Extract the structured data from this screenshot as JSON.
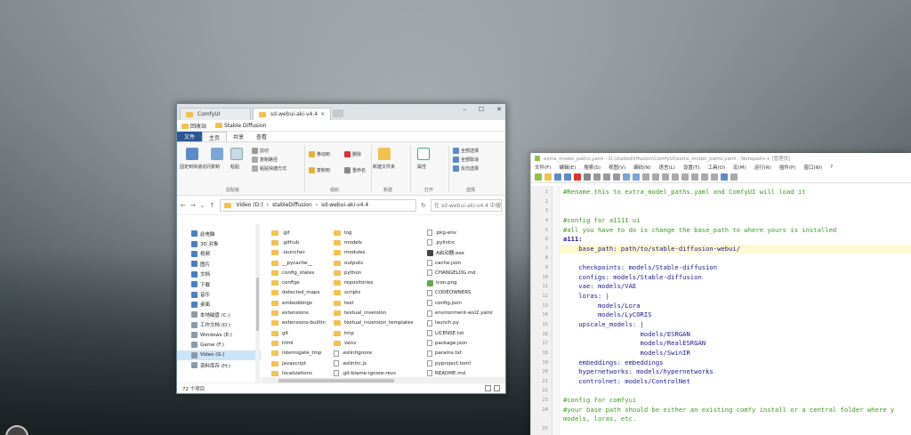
{
  "explorer": {
    "tabs": [
      {
        "label": "ComfyUI"
      },
      {
        "label": "sd-webui-aki-v4.4"
      }
    ],
    "window_controls": [
      "–",
      "☐",
      "✕"
    ],
    "favorites": [
      "回收站",
      "Stable Diffusion"
    ],
    "ribbon_tabs": [
      "文件",
      "主页",
      "共享",
      "查看"
    ],
    "ribbon": {
      "clipboard": {
        "pin": "固定到快速访问",
        "copy": "复制",
        "paste": "粘贴",
        "cut": "剪切",
        "copy_path": "复制路径",
        "paste_shortcut": "粘贴快捷方式",
        "group": "剪贴板"
      },
      "organize": {
        "move_to": "移动到",
        "delete": "删除",
        "copy_to": "复制到",
        "rename": "重命名",
        "group": "组织"
      },
      "new": {
        "new_folder": "新建文件夹",
        "group": "新建"
      },
      "open": {
        "properties": "属性",
        "group": "打开"
      },
      "select": {
        "select_all": "全部选择",
        "select_none": "全部取消",
        "invert": "反向选择",
        "group": "选择"
      }
    },
    "address": {
      "path": [
        "Video (D:)",
        "stableDiffusion",
        "sd-webui-aki-v4.4"
      ],
      "search_placeholder": "在 sd-webui-aki-v4.4 中搜索"
    },
    "nav_items": [
      {
        "label": "此电脑",
        "icon": "computer-icon"
      },
      {
        "label": "3D 对象",
        "icon": "cube-icon"
      },
      {
        "label": "视频",
        "icon": "video-icon"
      },
      {
        "label": "图片",
        "icon": "picture-icon"
      },
      {
        "label": "文档",
        "icon": "document-icon"
      },
      {
        "label": "下载",
        "icon": "download-icon"
      },
      {
        "label": "音乐",
        "icon": "music-icon"
      },
      {
        "label": "桌面",
        "icon": "desktop-icon"
      },
      {
        "label": "本地磁盘 (C:)",
        "icon": "drive-icon"
      },
      {
        "label": "工作文档 (D:)",
        "icon": "drive-icon"
      },
      {
        "label": "Windows (E:)",
        "icon": "drive-icon"
      },
      {
        "label": "Game (F:)",
        "icon": "drive-icon"
      },
      {
        "label": "Video (G:)",
        "icon": "drive-icon",
        "selected": true
      },
      {
        "label": "资料库存 (H:)",
        "icon": "drive-icon"
      }
    ],
    "files": {
      "col1": [
        ".git",
        ".github",
        ".launcher",
        "__pycache__",
        "config_states",
        "configs",
        "detected_maps",
        "embeddings",
        "extensions",
        "extensions-builtin",
        "git",
        "html",
        "interrogate_tmp",
        "javascript",
        "localizations"
      ],
      "col2": [
        "log",
        "models",
        "modules",
        "outputs",
        "python",
        "repositories",
        "scripts",
        "test",
        "textual_inversion",
        "textual_inversion_templates",
        "tmp",
        "venv",
        ".eslintignore",
        ".eslintrc.js",
        ".git-blame-ignore-revs"
      ],
      "col3": [
        ".pkg-env",
        ".pylintrc",
        "A启动器.exe",
        "cache.json",
        "CHANGELOG.md",
        "icon.png",
        "CODEOWNERS",
        "config.json",
        "environment-wsl2.yaml",
        "launch.py",
        "LICENSE.txt",
        "package.json",
        "params.txt",
        "pyproject.toml",
        "README.md"
      ]
    },
    "file_icons": {
      "col3": [
        "file",
        "file",
        "exe",
        "file",
        "file",
        "image",
        "file",
        "file",
        "file",
        "file",
        "file",
        "file",
        "file",
        "file",
        "file"
      ]
    },
    "status": "72 个项目"
  },
  "notepad": {
    "title": "extra_model_paths.yaml - D:\\stableDiffusion\\ComfyUI\\extra_model_paths.yaml - Notepad++ [管理员]",
    "menu": [
      "文件(F)",
      "编辑(E)",
      "搜索(S)",
      "视图(V)",
      "编码(N)",
      "语言(L)",
      "设置(T)",
      "工具(O)",
      "宏(M)",
      "运行(R)",
      "插件(P)",
      "窗口(W)",
      "?"
    ],
    "lines": [
      {
        "n": "1",
        "t": "#Rename this to extra_model_paths.yaml and ComfyUI will load it",
        "c": "cmt"
      },
      {
        "n": "2",
        "t": "",
        "c": ""
      },
      {
        "n": "3",
        "t": "",
        "c": ""
      },
      {
        "n": "4",
        "t": "#config for a1111 ui",
        "c": "cmt"
      },
      {
        "n": "5",
        "t": "#all you have to do is change the base_path to where yours is installed",
        "c": "cmt"
      },
      {
        "n": "6",
        "t": "a111:",
        "c": "key"
      },
      {
        "n": "7",
        "t": "    base_path: path/to/stable-diffusion-webui/",
        "c": "val",
        "hl": true
      },
      {
        "n": "8",
        "t": "",
        "c": ""
      },
      {
        "n": "9",
        "t": "    checkpoints: models/Stable-diffusion",
        "c": "val"
      },
      {
        "n": "10",
        "t": "    configs: models/Stable-diffusion",
        "c": "val"
      },
      {
        "n": "11",
        "t": "    vae: models/VAE",
        "c": "val"
      },
      {
        "n": "12",
        "t": "    loras: |",
        "c": "val"
      },
      {
        "n": "13",
        "t": "         models/Lora",
        "c": "val"
      },
      {
        "n": "14",
        "t": "         models/LyCORIS",
        "c": "val"
      },
      {
        "n": "15",
        "t": "    upscale_models: |",
        "c": "val"
      },
      {
        "n": "16",
        "t": "                    models/ESRGAN",
        "c": "val"
      },
      {
        "n": "17",
        "t": "                    models/RealESRGAN",
        "c": "val"
      },
      {
        "n": "18",
        "t": "                    models/SwinIR",
        "c": "val"
      },
      {
        "n": "19",
        "t": "    embeddings: embeddings",
        "c": "val"
      },
      {
        "n": "20",
        "t": "    hypernetworks: models/hypernetworks",
        "c": "val"
      },
      {
        "n": "21",
        "t": "    controlnet: models/ControlNet",
        "c": "val"
      },
      {
        "n": "22",
        "t": "",
        "c": ""
      },
      {
        "n": "23",
        "t": "#config for comfyui",
        "c": "cmt"
      },
      {
        "n": "24",
        "t": "#your base path should be either an existing comfy install or a central folder where y",
        "c": "cmt"
      },
      {
        "n": "",
        "t": "models, loras, etc.",
        "c": "cmt"
      },
      {
        "n": "25",
        "t": "",
        "c": ""
      },
      {
        "n": "26",
        "t": "",
        "c": ""
      }
    ]
  }
}
